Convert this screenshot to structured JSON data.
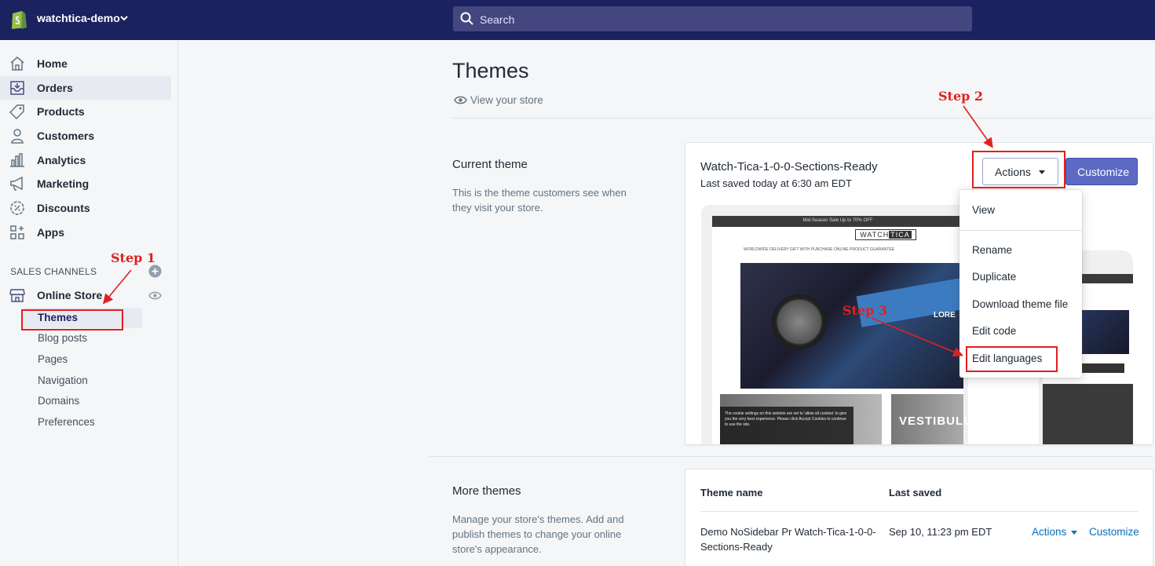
{
  "topbar": {
    "store_name": "watchtica-demo",
    "search_placeholder": "Search"
  },
  "sidebar": {
    "items": [
      {
        "label": "Home",
        "icon": "home-icon"
      },
      {
        "label": "Orders",
        "icon": "orders-icon"
      },
      {
        "label": "Products",
        "icon": "tag-icon"
      },
      {
        "label": "Customers",
        "icon": "person-icon"
      },
      {
        "label": "Analytics",
        "icon": "bar-chart-icon"
      },
      {
        "label": "Marketing",
        "icon": "megaphone-icon"
      },
      {
        "label": "Discounts",
        "icon": "discount-icon"
      },
      {
        "label": "Apps",
        "icon": "apps-icon"
      }
    ],
    "sales_channels_heading": "SALES CHANNELS",
    "online_store_label": "Online Store",
    "sub_items": [
      "Themes",
      "Blog posts",
      "Pages",
      "Navigation",
      "Domains",
      "Preferences"
    ]
  },
  "main": {
    "title": "Themes",
    "view_store": "View your store",
    "current_theme": {
      "heading": "Current theme",
      "description": "This is the theme customers see when they visit your store.",
      "theme_name": "Watch-Tica-1-0-0-Sections-Ready",
      "last_saved": "Last saved today at 6:30 am EDT",
      "actions_label": "Actions",
      "customize_label": "Customize"
    },
    "preview": {
      "banner": "Mid-Season Sale Up to 70% OFF",
      "logo_a": "WATCH",
      "logo_b": "TICA",
      "features": "WORLDWIDE DELIVERY     GIFT WITH PURCHASE     ONLINE PRODUCT GUARANTEE",
      "hero_text": "LORE",
      "tile_text": "VESTIBULUM",
      "cookie_text": "The cookie settings on this website are set to 'allow all cookies' to give you the very best experience. Please click Accept Cookies to continue to use the site."
    },
    "dropdown": [
      "View",
      "Rename",
      "Duplicate",
      "Download theme file",
      "Edit code",
      "Edit languages"
    ],
    "more_themes": {
      "heading": "More themes",
      "description": "Manage your store's themes. Add and publish themes to change your online store's appearance.",
      "col_name": "Theme name",
      "col_saved": "Last saved",
      "rows": [
        {
          "name": "Demo NoSidebar Pr Watch-Tica-1-0-0-Sections-Ready",
          "saved": "Sep 10, 11:23 pm EDT",
          "actions": "Actions",
          "customize": "Customize"
        }
      ]
    }
  },
  "annotations": {
    "step1": "Step 1",
    "step2": "Step 2",
    "step3": "Step 3",
    "color": "#e02020"
  }
}
